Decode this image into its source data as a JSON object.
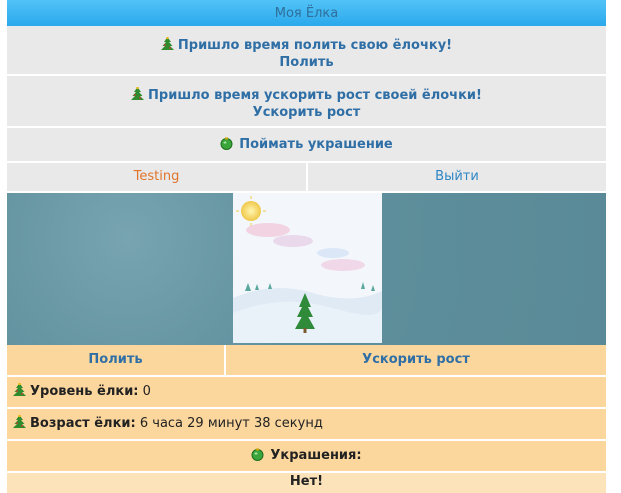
{
  "header": {
    "title": "Моя Ёлка"
  },
  "notices": [
    {
      "text": "Пришло время полить свою ёлочку!",
      "action": "Полить"
    },
    {
      "text": "Пришло время ускорить рост своей ёлочки!",
      "action": "Ускорить рост"
    }
  ],
  "catch_decoration": {
    "label": "Поймать украшение"
  },
  "tabs": {
    "user": "Testing",
    "logout": "Выйти"
  },
  "actions": {
    "water": "Полить",
    "speed_up": "Ускорить рост"
  },
  "tree_info": {
    "level_label": "Уровень ёлки:",
    "level_value": "0",
    "age_label": "Возраст ёлки:",
    "age_value": "6 часа 29 минут 38 секунд"
  },
  "decorations": {
    "title": "Украшения:",
    "status": "Нет!"
  },
  "colors": {
    "accent_blue": "#2f6fa6",
    "orange_panel": "#fcd79d",
    "gray_panel": "#e9e9e9",
    "top_bar": "#2aa9ec"
  },
  "icons": {
    "tree": "tree-icon",
    "ornament": "ornament-icon"
  }
}
